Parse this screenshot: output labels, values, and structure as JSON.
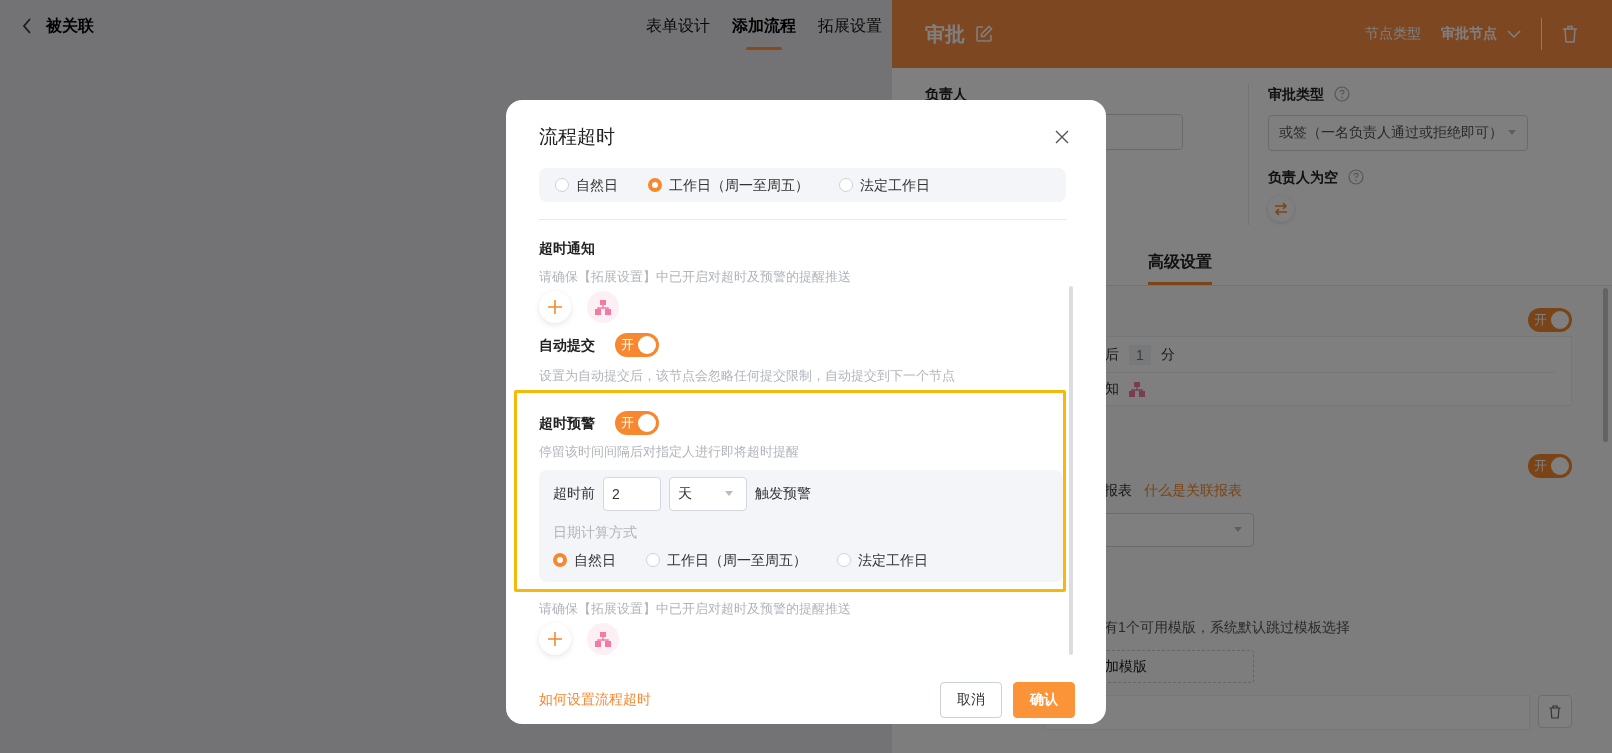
{
  "page": {
    "back_title": "被关联",
    "tabs": [
      {
        "label": "表单设计",
        "selected": false
      },
      {
        "label": "添加流程",
        "selected": true
      },
      {
        "label": "拓展设置",
        "selected": false
      }
    ]
  },
  "node_panel": {
    "title": "审批",
    "node_type_label": "节点类型",
    "node_type": "审批节点",
    "owner_label": "负责人",
    "approval_type_label": "审批类型",
    "approval_type": "或签（一名负责人通过或拒绝即可）",
    "empty_owner_label": "负责人为空",
    "tabs": [
      {
        "label": "高级设置",
        "selected": true
      }
    ],
    "timeout": {
      "toggle": {
        "label": "开",
        "on": true
      },
      "after_text": "后",
      "amount": "1",
      "unit": "分",
      "notify_text": "知"
    },
    "report": {
      "toggle": {
        "label": "开",
        "on": true
      },
      "label": "报表",
      "link": "什么是关联报表"
    },
    "template": {
      "hint": "有1个可用模版，系统默认跳过模板选择",
      "add_label": "加模版"
    }
  },
  "dialog": {
    "title": "流程超时",
    "day_options": [
      {
        "label": "自然日",
        "selected": false
      },
      {
        "label": "工作日（周一至周五）",
        "selected": true
      },
      {
        "label": "法定工作日",
        "selected": false
      }
    ],
    "notify": {
      "title": "超时通知",
      "hint": "请确保【拓展设置】中已开启对超时及预警的提醒推送"
    },
    "auto_submit": {
      "title": "自动提交",
      "toggle": {
        "label": "开",
        "on": true
      },
      "hint": "设置为自动提交后，该节点会忽略任何提交限制，自动提交到下一个节点"
    },
    "warning": {
      "title": "超时预警",
      "toggle": {
        "label": "开",
        "on": true
      },
      "hint": "停留该时间间隔后对指定人进行即将超时提醒",
      "before_label": "超时前",
      "amount": "2",
      "unit": "天",
      "after_label": "触发预警",
      "date_mode_label": "日期计算方式",
      "day_options": [
        {
          "label": "自然日",
          "selected": true
        },
        {
          "label": "工作日（周一至周五）",
          "selected": false
        },
        {
          "label": "法定工作日",
          "selected": false
        }
      ],
      "notice_hint": "请确保【拓展设置】中已开启对超时及预警的提醒推送"
    },
    "help_link": "如何设置流程超时",
    "buttons": [
      {
        "label": "取消",
        "kind": "secondary"
      },
      {
        "label": "确认",
        "kind": "primary"
      }
    ]
  }
}
